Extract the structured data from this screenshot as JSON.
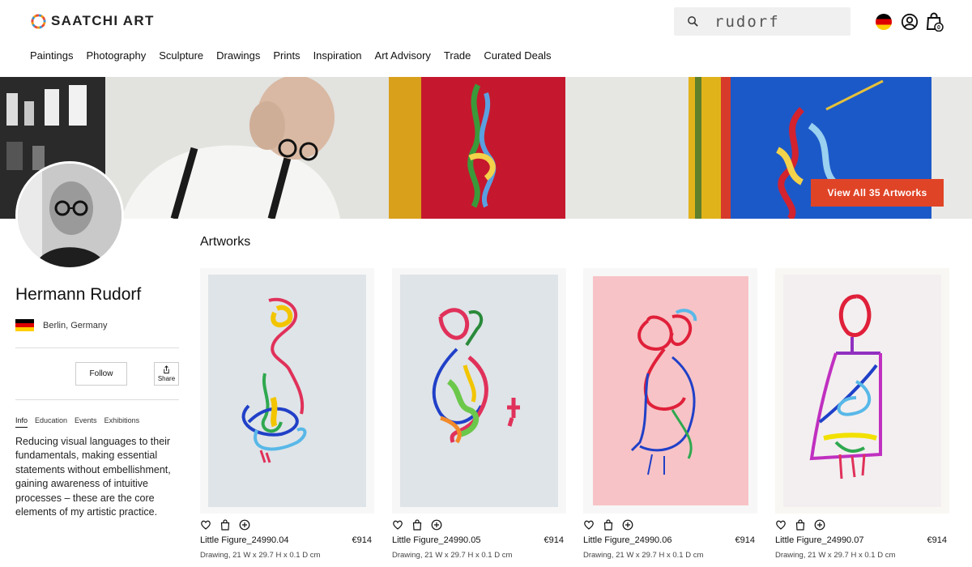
{
  "brand": {
    "name": "SAATCHI ART"
  },
  "header": {
    "search": {
      "value": "rudorf",
      "icon": "search-icon"
    },
    "icons": [
      "flag-icon-germany",
      "user-account-icon",
      "shopping-bag-icon"
    ],
    "cart_count": "0"
  },
  "nav": {
    "items": [
      {
        "label": "Paintings"
      },
      {
        "label": "Photography"
      },
      {
        "label": "Sculpture"
      },
      {
        "label": "Drawings"
      },
      {
        "label": "Prints"
      },
      {
        "label": "Inspiration"
      },
      {
        "label": "Art Advisory"
      },
      {
        "label": "Trade"
      },
      {
        "label": "Curated Deals"
      }
    ]
  },
  "banner": {
    "cta_label": "View All 35 Artworks"
  },
  "artist": {
    "name": "Hermann Rudorf",
    "location": "Berlin, Germany",
    "follow_label": "Follow",
    "share_label": "Share",
    "tabs": [
      {
        "label": "Info",
        "active": true
      },
      {
        "label": "Education"
      },
      {
        "label": "Events"
      },
      {
        "label": "Exhibitions"
      }
    ],
    "bio": "Reducing visual languages to their fundamentals, making essential statements without embellishment, gaining awareness of intuitive processes – these are the core elements of my artistic practice."
  },
  "artworks": {
    "title": "Artworks",
    "items": [
      {
        "title": "Little Figure_24990.04",
        "price": "€914",
        "meta": "Drawing, 21 W x 29.7 H x 0.1 D cm"
      },
      {
        "title": "Little Figure_24990.05",
        "price": "€914",
        "meta": "Drawing, 21 W x 29.7 H x 0.1 D cm"
      },
      {
        "title": "Little Figure_24990.06",
        "price": "€914",
        "meta": "Drawing, 21 W x 29.7 H x 0.1 D cm"
      },
      {
        "title": "Little Figure_24990.07",
        "price": "€914",
        "meta": "Drawing, 21 W x 29.7 H x 0.1 D cm"
      }
    ]
  },
  "colors": {
    "accent": "#e04427",
    "text": "#111111",
    "search_bg": "#f0f0f0"
  }
}
